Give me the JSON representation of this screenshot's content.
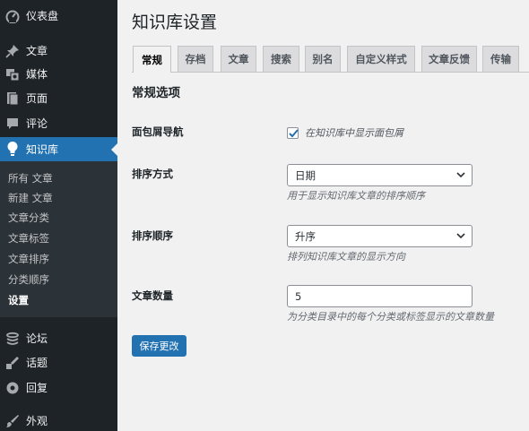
{
  "sidebar": {
    "dashboard": "仪表盘",
    "posts": "文章",
    "media": "媒体",
    "pages": "页面",
    "comments": "评论",
    "knowledge_base": "知识库",
    "submenu": [
      "所有 文章",
      "新建 文章",
      "文章分类",
      "文章标签",
      "文章排序",
      "分类顺序",
      "设置"
    ],
    "forums": "论坛",
    "topics": "话题",
    "replies": "回复",
    "appearance": "外观"
  },
  "page": {
    "title": "知识库设置",
    "tabs": [
      "常规",
      "存档",
      "文章",
      "搜索",
      "别名",
      "自定义样式",
      "文章反馈",
      "传输"
    ],
    "active_tab": "常规",
    "section_title": "常规选项"
  },
  "form": {
    "breadcrumbs": {
      "label": "面包屑导航",
      "checkbox_label": "在知识库中显示面包屑",
      "checked": true
    },
    "sort_by": {
      "label": "排序方式",
      "value": "日期",
      "description": "用于显示知识库文章的排序顺序"
    },
    "sort_order": {
      "label": "排序顺序",
      "value": "升序",
      "description": "排列知识库文章的显示方向"
    },
    "article_count": {
      "label": "文章数量",
      "value": "5",
      "description": "为分类目录中的每个分类或标签显示的文章数量"
    },
    "save_label": "保存更改"
  },
  "colors": {
    "sidebar_bg": "#1d2327",
    "submenu_bg": "#2c3338",
    "accent": "#2271b1",
    "page_bg": "#f1f1f1"
  }
}
